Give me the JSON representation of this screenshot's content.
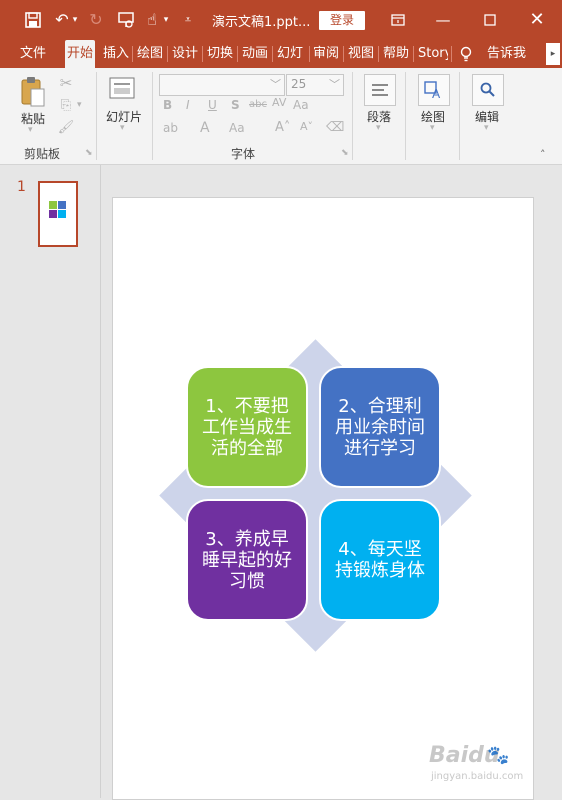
{
  "titlebar": {
    "doc_title": "演示文稿1.ppt...",
    "signin": "登录",
    "icons": [
      "save-icon",
      "undo-icon",
      "redo-icon",
      "present-icon",
      "touch-icon",
      "customize-icon"
    ]
  },
  "tabs": [
    "文件",
    "开始",
    "插入",
    "绘图",
    "设计",
    "切换",
    "动画",
    "幻灯",
    "审阅",
    "视图",
    "帮助",
    "Story"
  ],
  "tellme": "告诉我",
  "ribbon": {
    "paste": "粘贴",
    "clipboard_group": "剪贴板",
    "new_slide": "幻灯片",
    "font_group": "字体",
    "font_size": "25",
    "paragraph": "段落",
    "drawing": "绘图",
    "editing": "编辑"
  },
  "slides_panel": {
    "number": "1"
  },
  "slide": {
    "items": [
      {
        "text": "1、不要把工作当成生活的全部",
        "color": "#8dc63f"
      },
      {
        "text": "2、合理利用业余时间进行学习",
        "color": "#4472c4"
      },
      {
        "text": "3、养成早睡早起的好习惯",
        "color": "#7030a0"
      },
      {
        "text": "4、每天坚持锻炼身体",
        "color": "#00b0f0"
      }
    ],
    "diamond_color": "#cdd4ea"
  },
  "watermark": {
    "brand": "Baidu",
    "sub": "jingyan.baidu.com"
  },
  "colors": {
    "accent": "#b7472a"
  }
}
